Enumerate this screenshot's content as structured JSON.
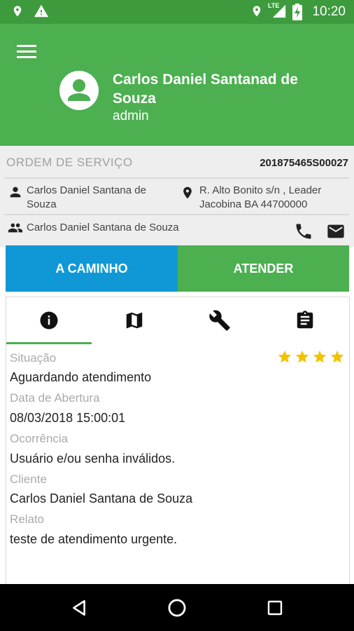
{
  "status_bar": {
    "time": "10:20",
    "network": "LTE",
    "icons": [
      "location-icon",
      "warning-icon",
      "location-icon",
      "lte-signal-icon",
      "battery-charging-icon"
    ]
  },
  "header": {
    "user_name": "Carlos Daniel Santanad de Souza",
    "user_role": "admin",
    "color": "#4caf50"
  },
  "order": {
    "label": "ORDEM DE SERVIÇO",
    "number": "201875465S00027",
    "client_name": "Carlos Daniel Santana de Souza",
    "address": "R. Alto Bonito s/n , Leader Jacobina BA 44700000",
    "contact_name": "Carlos Daniel Santana de Souza"
  },
  "actions": {
    "on_the_way": "A CAMINHO",
    "attend": "ATENDER",
    "on_the_way_color": "#0f98d5",
    "attend_color": "#4caf50"
  },
  "tabs": [
    {
      "icon": "info-icon",
      "selected": true
    },
    {
      "icon": "map-icon",
      "selected": false
    },
    {
      "icon": "wrench-icon",
      "selected": false
    },
    {
      "icon": "clipboard-icon",
      "selected": false
    }
  ],
  "rating": {
    "stars": 4,
    "max": 4,
    "color": "#f2c200"
  },
  "details": {
    "situacao_label": "Situação",
    "situacao_value": "Aguardando atendimento",
    "abertura_label": "Data de Abertura",
    "abertura_value": "08/03/2018 15:00:01",
    "ocorrencia_label": "Ocorrência",
    "ocorrencia_value": "Usuário e/ou senha inválidos.",
    "cliente_label": "Cliente",
    "cliente_value": "Carlos Daniel Santana de Souza",
    "relato_label": "Relato",
    "relato_value": "teste de atendimento urgente."
  }
}
